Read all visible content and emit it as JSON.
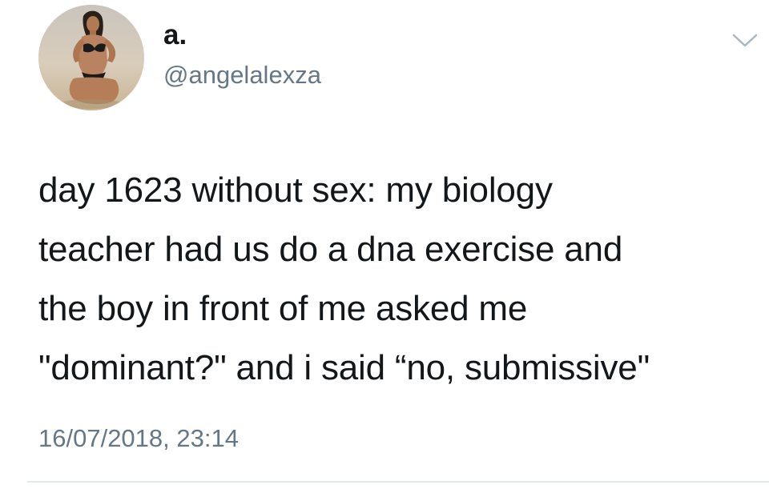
{
  "tweet": {
    "author": {
      "display_name": "a.",
      "handle": "@angelalexza",
      "avatar_icon": "profile-photo"
    },
    "menu_icon": "chevron-down-icon",
    "text_lines": [
      "day 1623 without sex: my biology",
      "teacher had us do a dna exercise and",
      "the boy in front of me asked me",
      "\"dominant?\" and i said “no, submissive\""
    ],
    "timestamp": "16/07/2018, 23:14"
  },
  "colors": {
    "text": "#14171a",
    "secondary_text": "#657786",
    "divider": "#e1e8ed",
    "background": "#ffffff"
  }
}
